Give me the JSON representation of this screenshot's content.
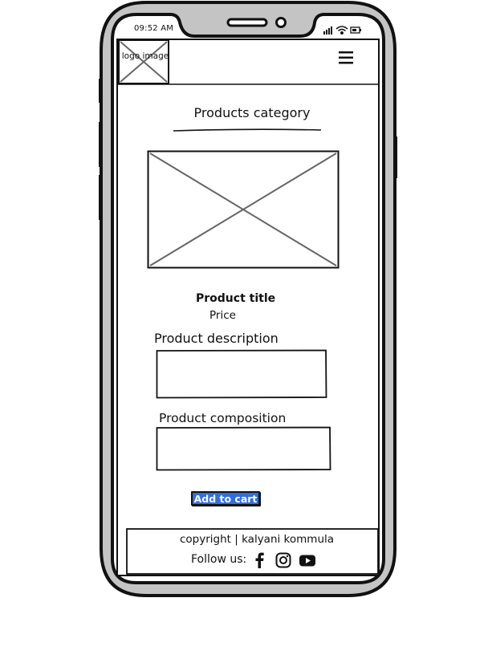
{
  "status_bar": {
    "time": "09:52 AM"
  },
  "header": {
    "logo_text": "logo image",
    "menu_icon": "hamburger-menu-icon"
  },
  "main": {
    "category_title": "Products category",
    "product_image_icon": "image-placeholder-icon",
    "product_title": "Product title",
    "price_label": "Price",
    "description_label": "Product description",
    "composition_label": "Product composition",
    "add_to_cart_label": "Add to cart",
    "accent_color": "#2f6fe0"
  },
  "footer": {
    "copyright": "copyright | kalyani kommula",
    "follow_label": "Follow us:",
    "social_icons": [
      "facebook-icon",
      "instagram-icon",
      "youtube-icon"
    ]
  }
}
